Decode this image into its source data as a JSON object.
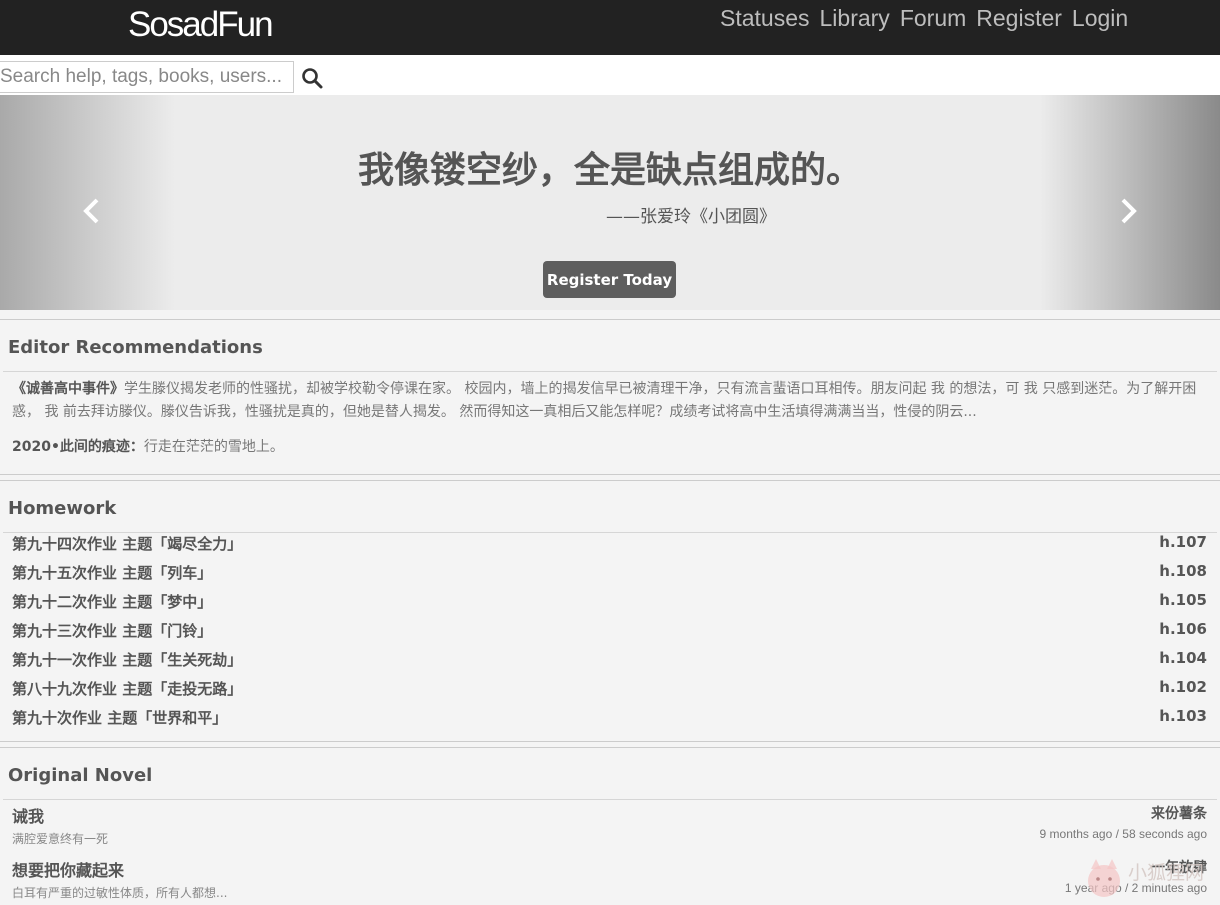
{
  "navbar": {
    "brand": "SosadFun",
    "links": [
      "Statuses",
      "Library",
      "Forum",
      "Register",
      "Login"
    ]
  },
  "search": {
    "placeholder": "Search help, tags, books, users..."
  },
  "hero": {
    "quote": "我像镂空纱，全是缺点组成的。",
    "author": "——张爱玲《小团圆》",
    "button": "Register Today"
  },
  "editor": {
    "heading": "Editor Recommendations",
    "items": [
      {
        "title": "《诚善高中事件》",
        "text": "学生滕仪揭发老师的性骚扰，却被学校勒令停课在家。 校园内，墙上的揭发信早已被清理干净，只有流言蜚语口耳相传。朋友问起 我 的想法，可 我 只感到迷茫。为了解开困惑， 我 前去拜访滕仪。滕仪告诉我，性骚扰是真的，但她是替人揭发。 然而得知这一真相后又能怎样呢？成绩考试将高中生活填得满满当当，性侵的阴云..."
      },
      {
        "title": "2020•此间的痕迹：",
        "text": "行走在茫茫的雪地上。"
      }
    ]
  },
  "homework": {
    "heading": "Homework",
    "items": [
      {
        "title": "第九十四次作业 主题「竭尽全力」",
        "code": "h.107"
      },
      {
        "title": "第九十五次作业 主题「列车」",
        "code": "h.108"
      },
      {
        "title": "第九十二次作业 主题「梦中」",
        "code": "h.105"
      },
      {
        "title": "第九十三次作业 主题「门铃」",
        "code": "h.106"
      },
      {
        "title": "第九十一次作业 主题「生关死劫」",
        "code": "h.104"
      },
      {
        "title": "第八十九次作业 主题「走投无路」",
        "code": "h.102"
      },
      {
        "title": "第九十次作业 主题「世界和平」",
        "code": "h.103"
      }
    ]
  },
  "novel": {
    "heading": "Original Novel",
    "items": [
      {
        "title": "诫我",
        "author": "来份薯条",
        "summary": "满腔爱意终有一死",
        "time": "9 months ago / 58 seconds ago"
      },
      {
        "title": "想要把你藏起来",
        "author": "一年放肆",
        "summary": "白耳有严重的过敏性体质，所有人都想...",
        "time": "1 year ago / 2 minutes ago"
      }
    ]
  },
  "watermark": "小狐狸网",
  "icons": [
    "search-icon",
    "chevron-left-icon",
    "chevron-right-icon",
    "fox-logo-icon"
  ]
}
